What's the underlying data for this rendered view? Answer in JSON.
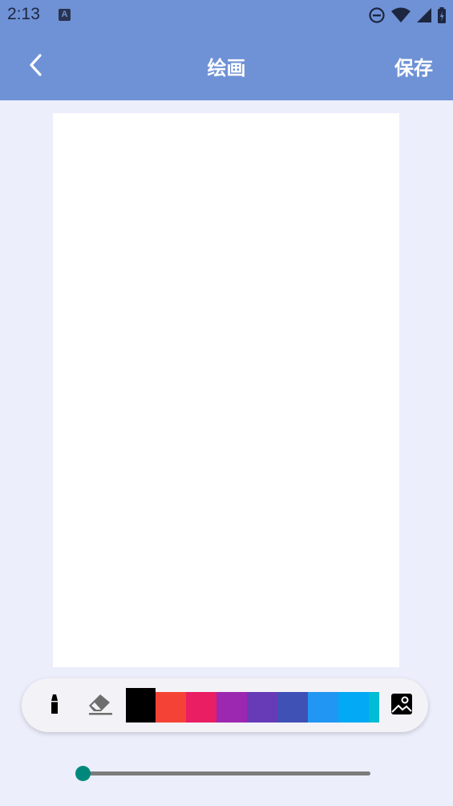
{
  "status_bar": {
    "time": "2:13",
    "notification_letter": "A"
  },
  "app_bar": {
    "title": "绘画",
    "save_label": "保存",
    "background_color": "#6F92D6"
  },
  "toolbar": {
    "tools": [
      "pen-icon",
      "eraser-icon",
      "image-icon"
    ],
    "palette": [
      {
        "name": "black",
        "color": "#000000",
        "selected": true
      },
      {
        "name": "red",
        "color": "#F44336"
      },
      {
        "name": "pink",
        "color": "#E91E63"
      },
      {
        "name": "purple",
        "color": "#9C27B0"
      },
      {
        "name": "deep-purple",
        "color": "#673AB7"
      },
      {
        "name": "indigo",
        "color": "#3F51B5"
      },
      {
        "name": "blue",
        "color": "#2196F3"
      },
      {
        "name": "light-blue",
        "color": "#03A9F4"
      },
      {
        "name": "cyan",
        "color": "#00BCD4"
      }
    ]
  },
  "brush_size_slider": {
    "value_fraction": 0.0,
    "thumb_color": "#00897B"
  }
}
